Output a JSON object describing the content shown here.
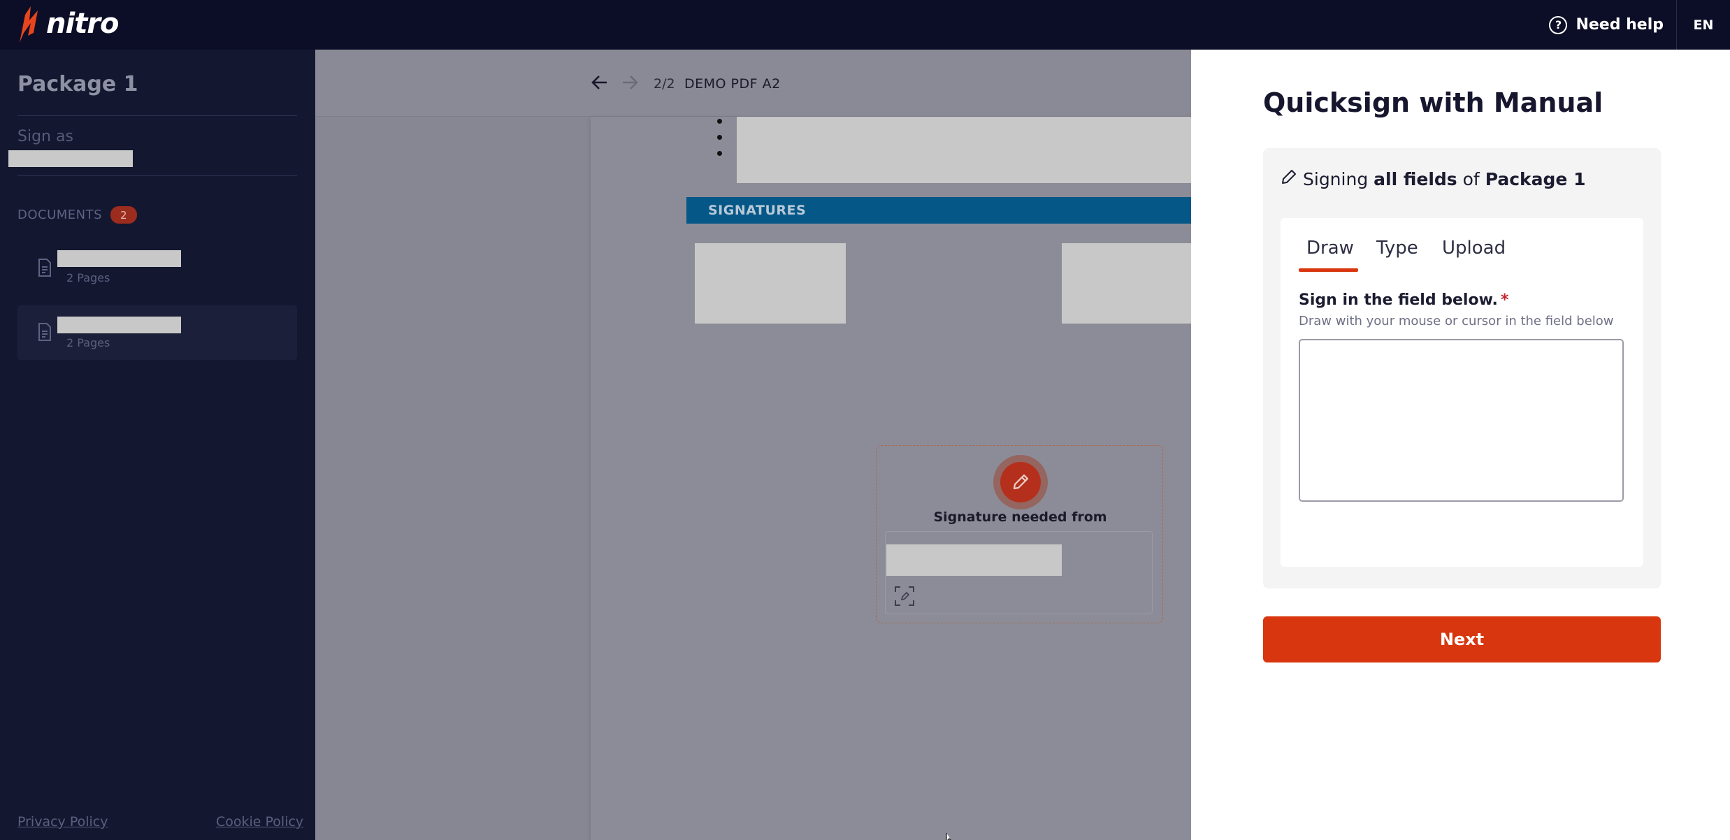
{
  "topbar": {
    "brand": "nitro",
    "help_label": "Need help",
    "language": "EN"
  },
  "sidebar": {
    "package_title": "Package 1",
    "sign_as_label": "Sign as",
    "documents_label": "DOCUMENTS",
    "documents_count": "2",
    "documents": [
      {
        "pages": "2 Pages"
      },
      {
        "pages": "2 Pages"
      }
    ],
    "privacy_policy": "Privacy Policy",
    "cookie_policy": "Cookie Policy"
  },
  "viewer": {
    "page_indicator": "2/2",
    "document_title": "DEMO PDF A2",
    "signatures_header": "SIGNATURES",
    "signature_needed": "Signature needed from"
  },
  "panel": {
    "title": "Quicksign with Manual",
    "signing_prefix": "Signing ",
    "signing_scope": "all fields",
    "signing_of": " of ",
    "signing_package": "Package 1",
    "tabs": [
      {
        "label": "Draw"
      },
      {
        "label": "Type"
      },
      {
        "label": "Upload"
      }
    ],
    "field_label": "Sign in the field below.",
    "required_mark": "*",
    "field_help": "Draw with your mouse or cursor in the field below",
    "next_label": "Next"
  },
  "colors": {
    "accent": "#d8360e",
    "topbar_bg": "#0c0e27",
    "sidebar_bg": "#131730",
    "signatures_header_bg": "#045786"
  }
}
